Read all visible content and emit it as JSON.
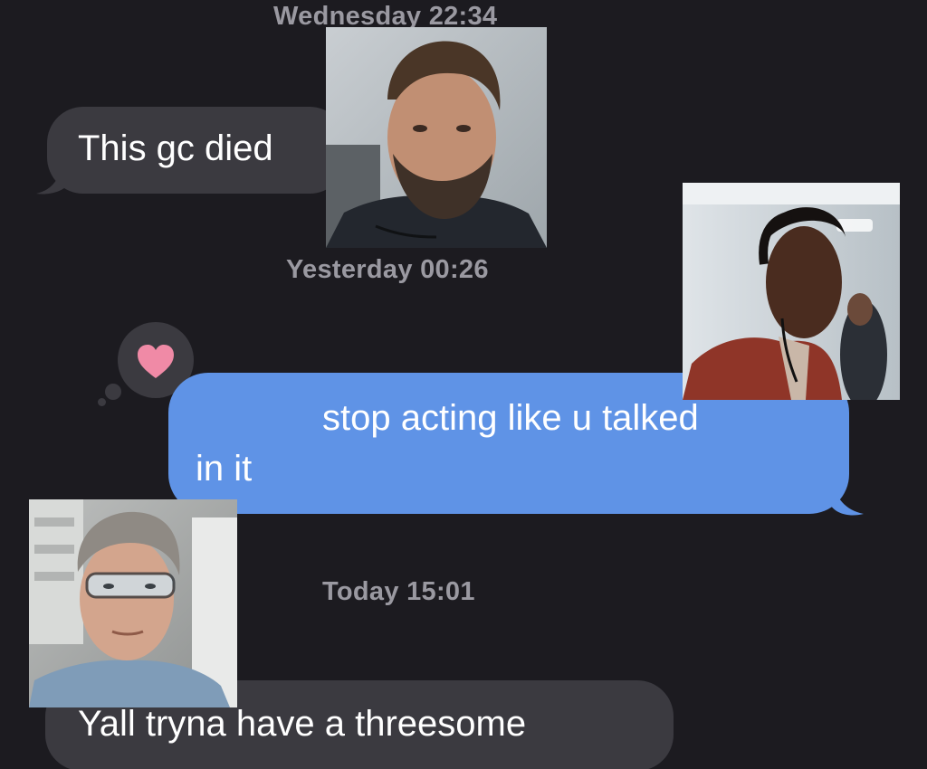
{
  "timestamps": {
    "first": "Wednesday 22:34",
    "second": "Yesterday 00:26",
    "third": "Today 15:01"
  },
  "messages": [
    {
      "direction": "incoming",
      "text": "This gc died"
    },
    {
      "direction": "outgoing",
      "text_line1": "stop acting like u talked",
      "text_line2": "in it",
      "reaction": "heart-icon"
    },
    {
      "direction": "incoming",
      "text": "Yall tryna have a threesome"
    }
  ],
  "colors": {
    "background": "#1c1b20",
    "incoming_bubble": "#3b3a40",
    "outgoing_bubble": "#5f93e6",
    "timestamp_text": "#9a99a1",
    "reaction_heart": "#f08aa6"
  },
  "overlays": [
    {
      "name": "man-with-beard-photo"
    },
    {
      "name": "woman-in-red-jacket-photo"
    },
    {
      "name": "man-with-safety-glasses-photo"
    }
  ]
}
